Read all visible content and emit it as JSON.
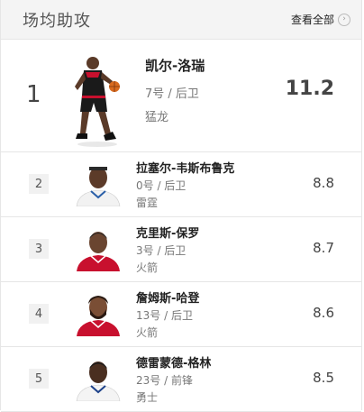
{
  "header": {
    "title": "场均助攻",
    "view_all": "查看全部"
  },
  "leader": {
    "rank": "1",
    "name": "凯尔-洛瑞",
    "meta": "7号 / 后卫",
    "team": "猛龙",
    "value": "11.2",
    "jersey_color": "#111111"
  },
  "rows": [
    {
      "rank": "2",
      "name": "拉塞尔-韦斯布鲁克",
      "meta": "0号 / 后卫",
      "team": "雷霆",
      "value": "8.8",
      "jersey_color": "#ffffff"
    },
    {
      "rank": "3",
      "name": "克里斯-保罗",
      "meta": "3号 / 后卫",
      "team": "火箭",
      "value": "8.7",
      "jersey_color": "#c8102e"
    },
    {
      "rank": "4",
      "name": "詹姆斯-哈登",
      "meta": "13号 / 后卫",
      "team": "火箭",
      "value": "8.6",
      "jersey_color": "#c8102e"
    },
    {
      "rank": "5",
      "name": "德雷蒙德-格林",
      "meta": "23号 / 前锋",
      "team": "勇士",
      "value": "8.5",
      "jersey_color": "#ffffff"
    }
  ]
}
